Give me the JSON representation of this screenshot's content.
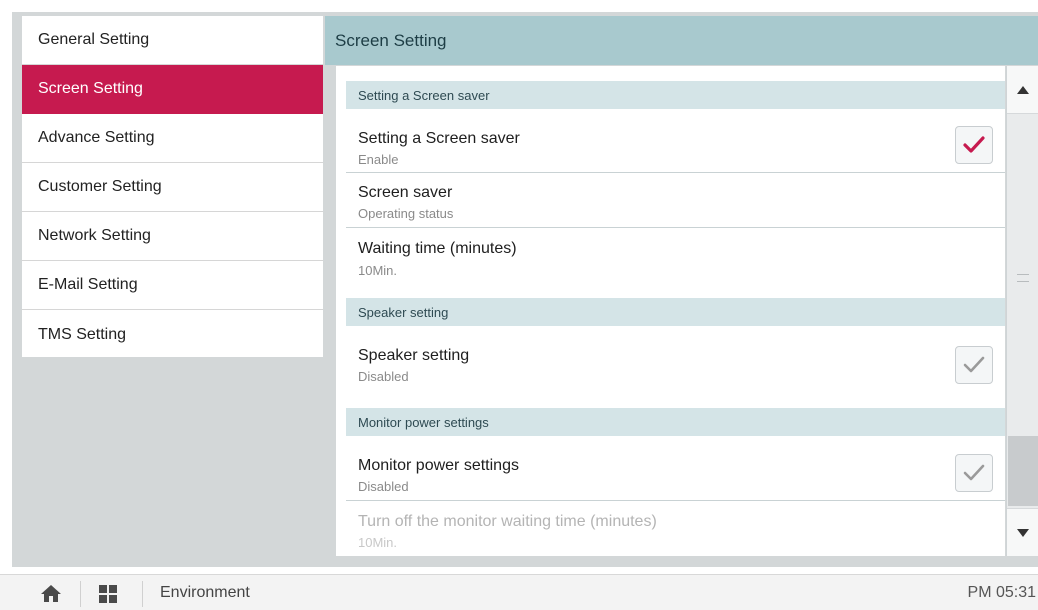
{
  "sidebar": {
    "items": [
      {
        "label": "General Setting",
        "active": false
      },
      {
        "label": "Screen Setting",
        "active": true
      },
      {
        "label": "Advance Setting",
        "active": false
      },
      {
        "label": "Customer Setting",
        "active": false
      },
      {
        "label": "Network Setting",
        "active": false
      },
      {
        "label": "E-Mail Setting",
        "active": false
      },
      {
        "label": "TMS Setting",
        "active": false
      }
    ]
  },
  "header": {
    "title": "Screen Setting"
  },
  "sections": [
    {
      "heading": "Setting a Screen saver",
      "rows": [
        {
          "title": "Setting a Screen saver",
          "subtitle": "Enable",
          "checked": true
        },
        {
          "title": "Screen saver",
          "subtitle": "Operating status"
        },
        {
          "title": "Waiting time (minutes)",
          "subtitle": "10Min."
        }
      ]
    },
    {
      "heading": "Speaker setting",
      "rows": [
        {
          "title": "Speaker setting",
          "subtitle": "Disabled",
          "checked": false
        }
      ]
    },
    {
      "heading": "Monitor power settings",
      "rows": [
        {
          "title": "Monitor power settings",
          "subtitle": "Disabled",
          "checked": false
        },
        {
          "title": "Turn off the monitor waiting time (minutes)",
          "subtitle": "10Min.",
          "disabled": true
        }
      ]
    }
  ],
  "bottombar": {
    "location": "Environment",
    "time": "PM 05:31",
    "icons": [
      "home-icon",
      "apps-grid-icon"
    ]
  },
  "colors": {
    "accent": "#c61a4f",
    "header": "#a8c9ce",
    "section_heading": "#d4e4e7",
    "check_on": "#c61a4f",
    "check_off": "#9a9a9a"
  }
}
